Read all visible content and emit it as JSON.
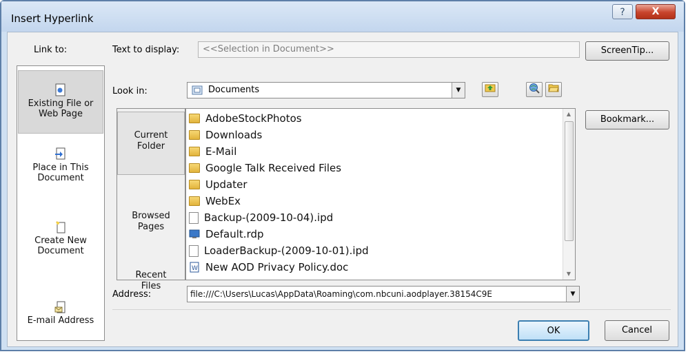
{
  "window": {
    "title": "Insert Hyperlink",
    "help_glyph": "?",
    "close_glyph": "X"
  },
  "link_to": {
    "label": "Link to:",
    "items": [
      {
        "line1": "Existing File or",
        "line2": "Web Page",
        "icon": "existing-file-icon"
      },
      {
        "line1": "Place in This",
        "line2": "Document",
        "icon": "place-in-document-icon"
      },
      {
        "line1": "Create New",
        "line2": "Document",
        "icon": "create-new-document-icon"
      },
      {
        "line1": "E-mail Address",
        "line2": "",
        "icon": "email-address-icon"
      }
    ]
  },
  "text_to_display": {
    "label": "Text to display:",
    "value": "<<Selection in Document>>"
  },
  "buttons": {
    "screentip": "ScreenTip...",
    "bookmark": "Bookmark...",
    "ok": "OK",
    "cancel": "Cancel"
  },
  "look_in": {
    "label": "Look in:",
    "value": "Documents"
  },
  "subnav": [
    {
      "line1": "Current",
      "line2": "Folder"
    },
    {
      "line1": "Browsed",
      "line2": "Pages"
    },
    {
      "line1": "Recent",
      "line2": "Files"
    }
  ],
  "files": [
    {
      "name": "AdobeStockPhotos",
      "type": "folder"
    },
    {
      "name": "Downloads",
      "type": "folder"
    },
    {
      "name": "E-Mail",
      "type": "folder"
    },
    {
      "name": "Google Talk Received Files",
      "type": "folder"
    },
    {
      "name": "Updater",
      "type": "folder"
    },
    {
      "name": "WebEx",
      "type": "folder"
    },
    {
      "name": "Backup-(2009-10-04).ipd",
      "type": "file"
    },
    {
      "name": "Default.rdp",
      "type": "file"
    },
    {
      "name": "LoaderBackup-(2009-10-01).ipd",
      "type": "file"
    },
    {
      "name": "New AOD Privacy Policy.doc",
      "type": "file"
    }
  ],
  "address": {
    "label": "Address:",
    "value": "file:///C:\\Users\\Lucas\\AppData\\Roaming\\com.nbcuni.aodplayer.38154C9E"
  },
  "colors": {
    "title_bar": "#c3d6ee",
    "close_button": "#c8442c",
    "folder": "#e2b33c"
  }
}
